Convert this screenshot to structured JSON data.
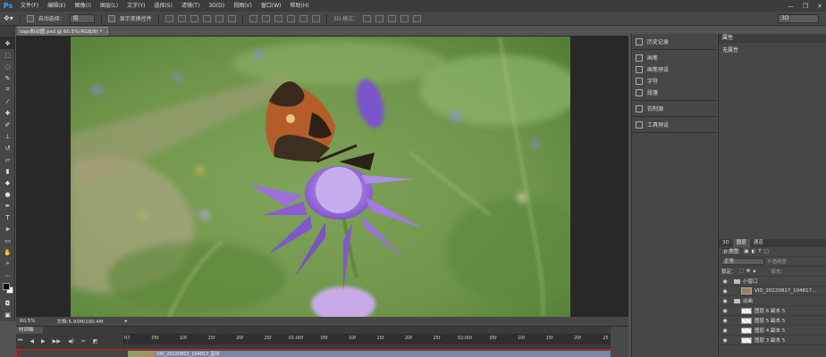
{
  "app": {
    "logo": "Ps"
  },
  "menu": [
    "文件(F)",
    "编辑(E)",
    "图像(I)",
    "图层(L)",
    "文字(Y)",
    "选择(S)",
    "滤镜(T)",
    "3D(D)",
    "视图(V)",
    "窗口(W)",
    "帮助(H)"
  ],
  "window_controls": [
    "—",
    "❐",
    "✕"
  ],
  "options": {
    "auto_select_label": "自动选择：",
    "auto_select_value": "组",
    "show_transform_label": "显示变换控件",
    "mode_3d_label": "3D 模式：",
    "workspace": "3D"
  },
  "document": {
    "tab_title": "logo和动图.psd @ 60.5%(RGB/8) *",
    "close": "×"
  },
  "status": {
    "zoom": "60.5%",
    "doc_size": "文档:5.93M/200.4M"
  },
  "timeline": {
    "tab": "时间轴",
    "ruler_labels": [
      "00",
      "05f",
      "10f",
      "15f",
      "20f",
      "25f",
      "01:00f",
      "05f",
      "10f",
      "15f",
      "20f",
      "25f",
      "02:00f",
      "05f",
      "10f",
      "15f",
      "20f",
      "25"
    ],
    "clip_name": "VID_20220802_104817_副本"
  },
  "mid_panel": {
    "groups": [
      [
        {
          "icon": "history-icon",
          "label": "历史记录"
        }
      ],
      [
        {
          "icon": "brush-icon",
          "label": "画笔"
        },
        {
          "icon": "brush-preset-icon",
          "label": "画笔预设"
        },
        {
          "icon": "character-icon",
          "label": "字符"
        },
        {
          "icon": "paragraph-icon",
          "label": "段落"
        }
      ],
      [
        {
          "icon": "clone-source-icon",
          "label": "仿制源"
        }
      ],
      [
        {
          "icon": "tool-preset-icon",
          "label": "工具预设"
        }
      ]
    ]
  },
  "properties": {
    "title": "属性",
    "content": "无属性"
  },
  "layers": {
    "tabs": [
      "3D",
      "图层",
      "通道"
    ],
    "filter": "ρ 类型",
    "blend_mode": "正常",
    "opacity_label": "不透明度：",
    "lock_label": "锁定：",
    "fill_label": "填充：",
    "items": [
      {
        "type": "group",
        "name": "小窗口",
        "indent": 0
      },
      {
        "type": "video",
        "name": "VID_20220817_104817...",
        "indent": 1
      },
      {
        "type": "group",
        "name": "动画",
        "indent": 0
      },
      {
        "type": "layer",
        "name": "图层 6 副本 5",
        "indent": 1
      },
      {
        "type": "layer",
        "name": "图层 5 副本 5",
        "indent": 1
      },
      {
        "type": "layer",
        "name": "图层 4 副本 5",
        "indent": 1
      },
      {
        "type": "layer",
        "name": "图层 3 副本 5",
        "indent": 1
      }
    ]
  }
}
